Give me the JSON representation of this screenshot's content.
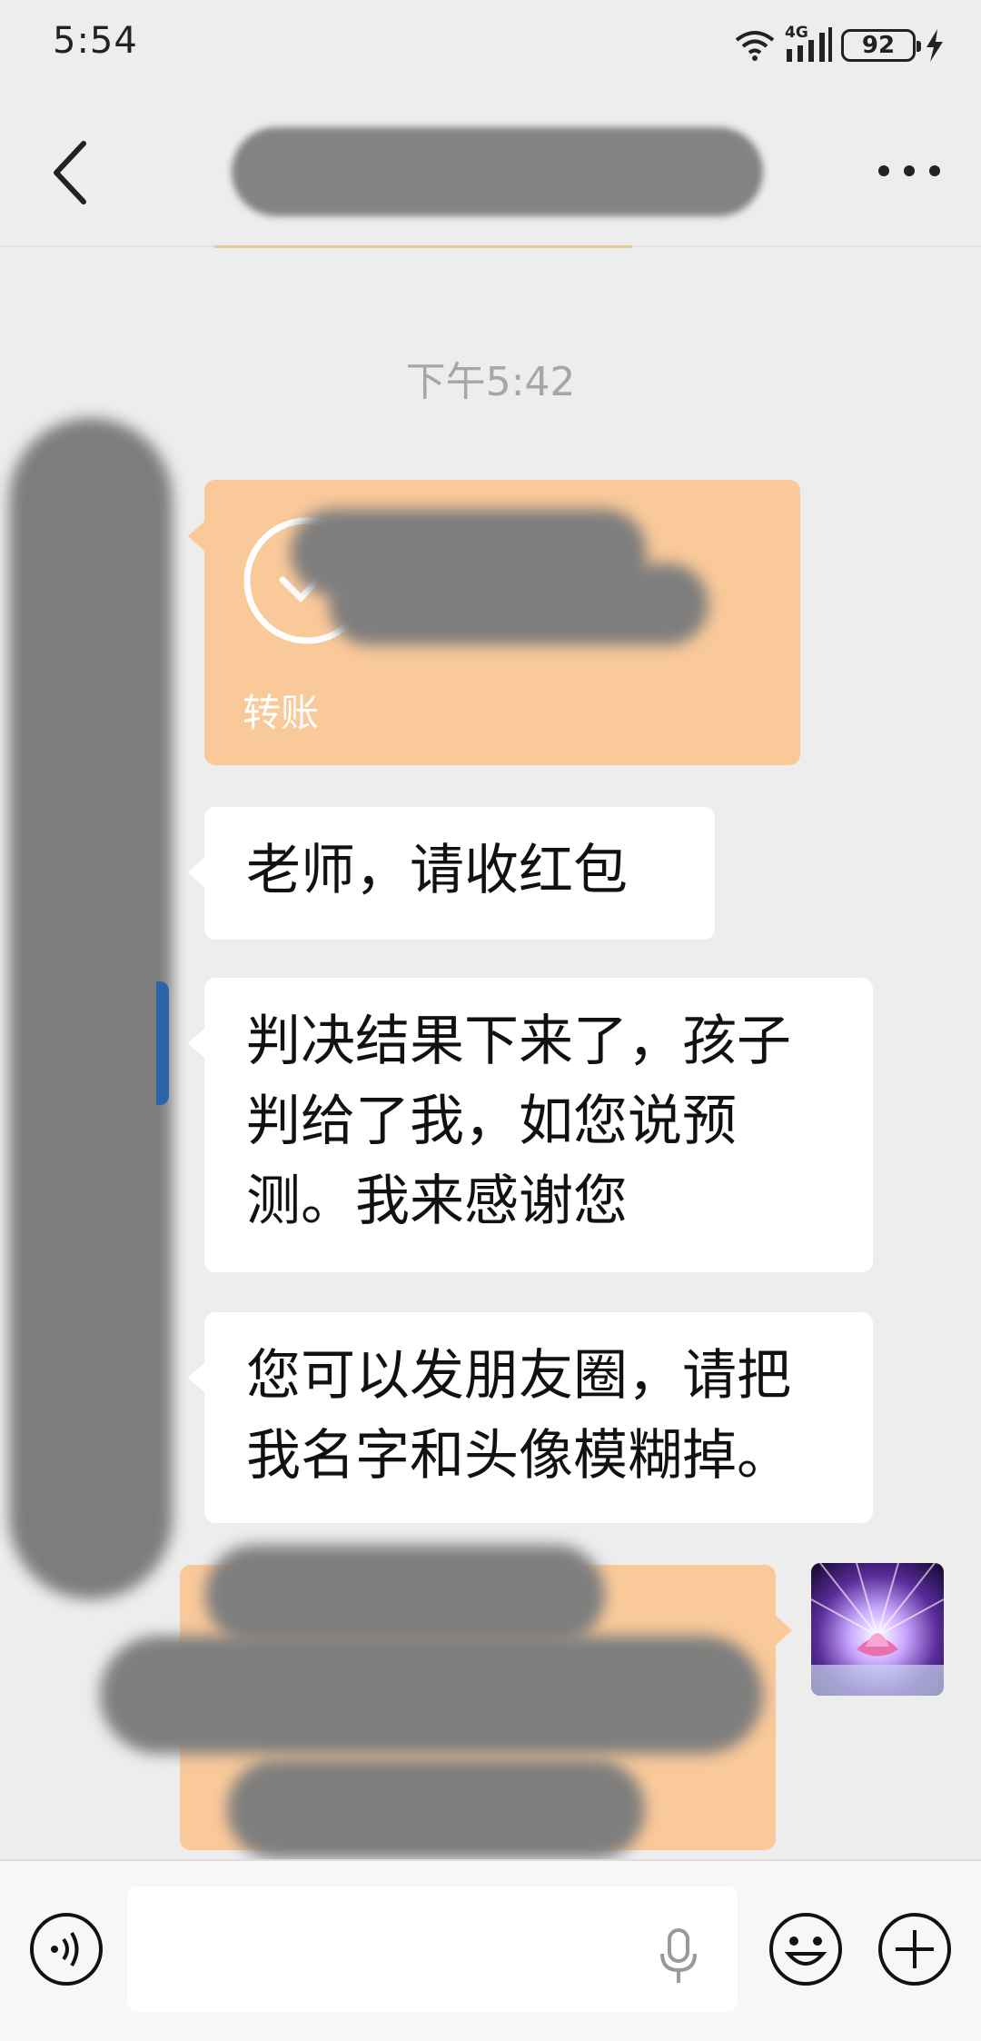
{
  "status_bar": {
    "time": "5:54",
    "battery": "92",
    "network": "4G",
    "icons": [
      "wifi-icon",
      "signal-icon",
      "battery-icon",
      "charging-icon"
    ]
  },
  "nav": {
    "back_icon": "chevron-left-icon",
    "more_icon": "more-icon"
  },
  "chat": {
    "time_label": "下午5:42",
    "transfer_incoming": {
      "label": "转账",
      "status_icon": "check-circle-icon"
    },
    "messages": [
      {
        "lines": [
          "老师，请收红包"
        ]
      },
      {
        "lines": [
          "判决结果下来了，孩子",
          "判给了我，如您说预",
          "测。我来感谢您"
        ]
      },
      {
        "lines": [
          "您可以发朋友圈，请把",
          "我名字和头像模糊掉。"
        ]
      }
    ]
  },
  "input_bar": {
    "voice_icon": "voice-icon",
    "mic_icon": "microphone-icon",
    "emoji_icon": "emoji-icon",
    "plus_icon": "plus-icon"
  },
  "colors": {
    "background": "#ededed",
    "transfer_card": "#f9c99a",
    "bubble": "#ffffff",
    "time_label": "#a6a6a6"
  }
}
